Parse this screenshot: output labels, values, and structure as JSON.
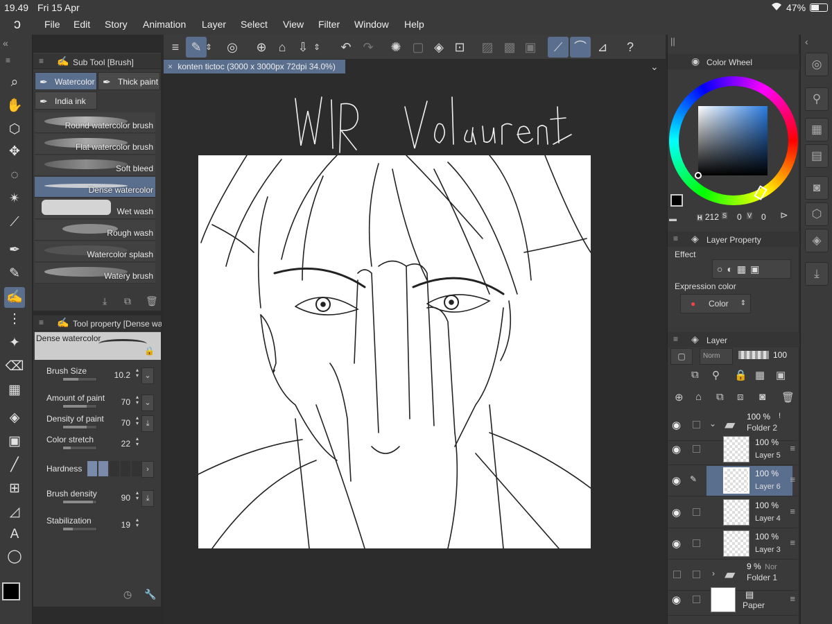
{
  "status": {
    "time": "19.49",
    "date": "Fri 15 Apr",
    "battery": "47%"
  },
  "menu": [
    "File",
    "Edit",
    "Story",
    "Animation",
    "Layer",
    "Select",
    "View",
    "Filter",
    "Window",
    "Help"
  ],
  "subtool": {
    "title": "Sub Tool [Brush]",
    "tabs": [
      "Watercolor",
      "Thick paint",
      "India ink"
    ],
    "brushes": [
      "Round watercolor brush",
      "Flat watercolor brush",
      "Soft bleed",
      "Dense watercolor",
      "Wet wash",
      "Rough wash",
      "Watercolor splash",
      "Watery brush"
    ]
  },
  "toolprop": {
    "title": "Tool property [Dense wa",
    "brush_name": "Dense watercolor",
    "props": [
      {
        "name": "Brush Size",
        "value": "10.2",
        "fill": 0.5
      },
      {
        "name": "Amount of paint",
        "value": "70",
        "fill": 0.7
      },
      {
        "name": "Density of paint",
        "value": "70",
        "fill": 0.7
      },
      {
        "name": "Color stretch",
        "value": "22",
        "fill": 0.22
      },
      {
        "name": "Hardness",
        "value": ""
      },
      {
        "name": "Brush density",
        "value": "90",
        "fill": 0.9
      },
      {
        "name": "Stabilization",
        "value": "19",
        "fill": 0.3
      }
    ]
  },
  "document": {
    "tab": "konten tictoc (3000 x 3000px 72dpi 34.0%)",
    "title_sketch": "WIP Valorant"
  },
  "colorwheel": {
    "title": "Color Wheel",
    "h_label": "H",
    "h": "212",
    "s_label": "S",
    "s": "0",
    "v_label": "V",
    "v": "0",
    "main_color": "#000000",
    "sub_color": "#ffffff"
  },
  "layerprop": {
    "title": "Layer Property",
    "effect_label": "Effect",
    "expression_label": "Expression color",
    "expression_value": "Color"
  },
  "layerpanel": {
    "title": "Layer",
    "blend": "Norm",
    "opacity": "100",
    "layers": [
      {
        "pct": "100 %",
        "mode": "!",
        "name": "Folder 2",
        "type": "folder",
        "open": true
      },
      {
        "pct": "100 %",
        "name": "Layer 5",
        "type": "raster"
      },
      {
        "pct": "100 %",
        "name": "Layer 6",
        "type": "raster",
        "selected": true
      },
      {
        "pct": "100 %",
        "name": "Layer 4",
        "type": "raster"
      },
      {
        "pct": "100 %",
        "name": "Layer 3",
        "type": "raster"
      },
      {
        "pct": "9 %",
        "mode": "Nor",
        "name": "Folder 1",
        "type": "folder",
        "open": false
      },
      {
        "pct": "",
        "name": "Paper",
        "type": "paper"
      }
    ]
  },
  "colors": {
    "accent": "#5a6e8e",
    "panel": "#3a3a3a",
    "canvas_bg": "#2c2c2c"
  }
}
